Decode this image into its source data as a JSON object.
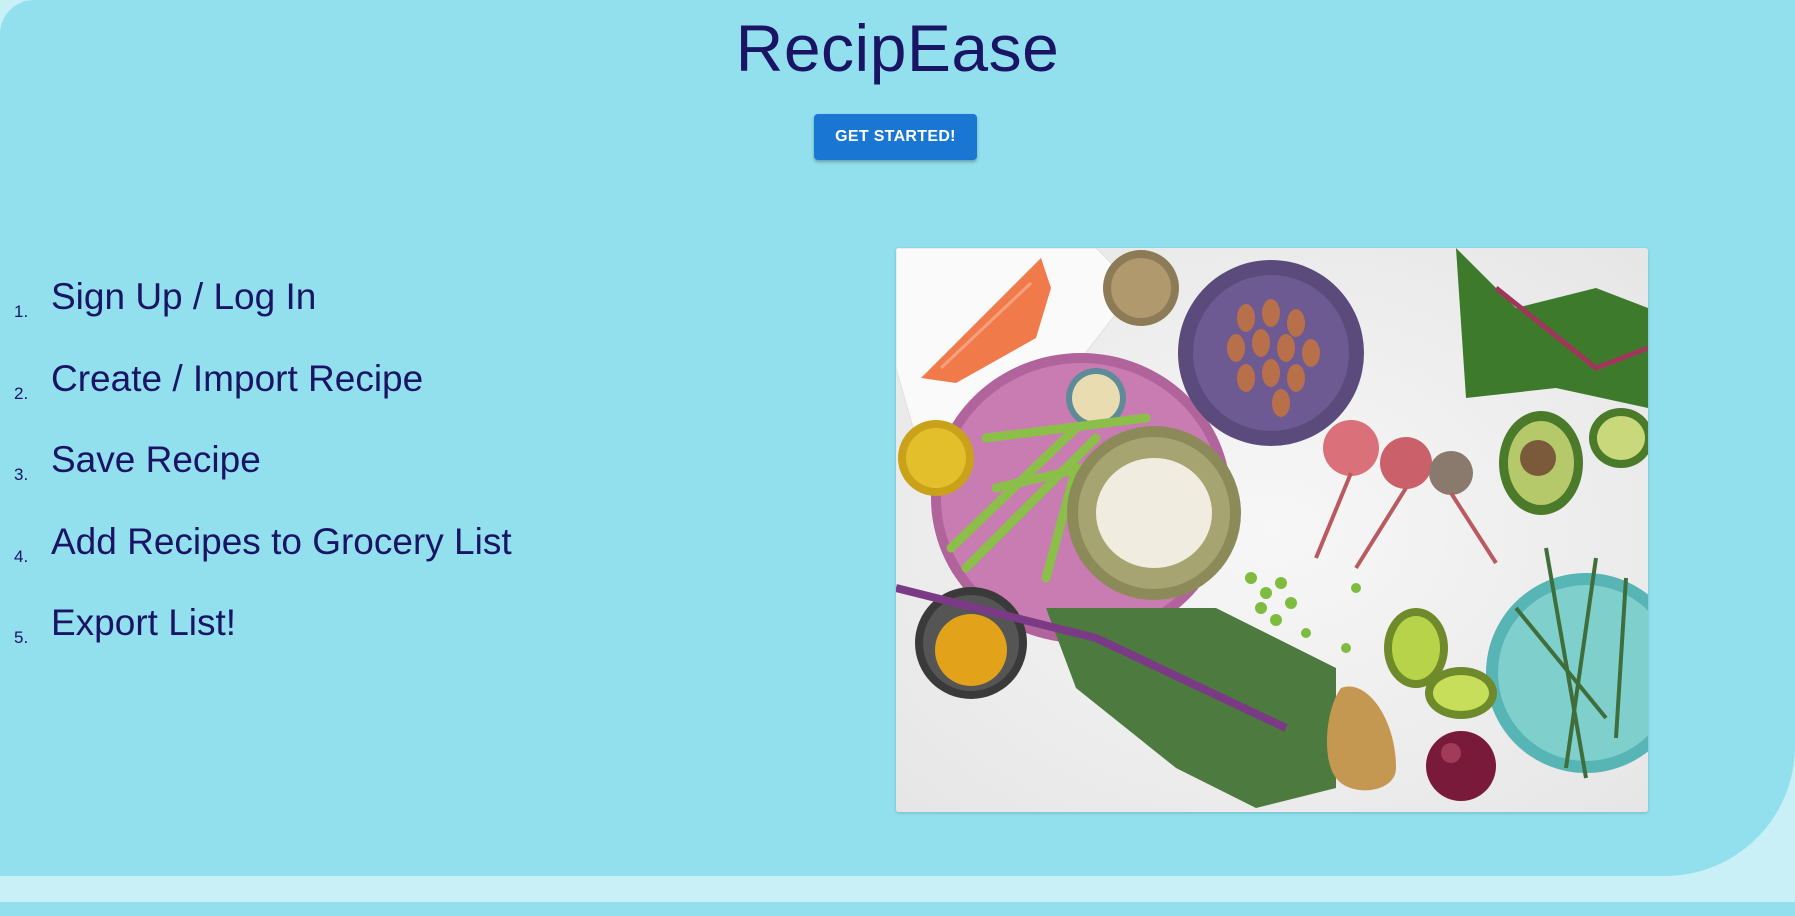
{
  "app": {
    "title": "RecipEase"
  },
  "hero": {
    "cta_label": "GET STARTED!"
  },
  "steps": [
    {
      "number": "1.",
      "label": "Sign Up / Log In"
    },
    {
      "number": "2.",
      "label": "Create / Import Recipe"
    },
    {
      "number": "3.",
      "label": "Save Recipe"
    },
    {
      "number": "4.",
      "label": "Add Recipes to Grocery List"
    },
    {
      "number": "5.",
      "label": "Export List!"
    }
  ],
  "colors": {
    "page_background": "#c9f0f7",
    "hero_background": "#92dfee",
    "text_primary": "#1a1464",
    "button_background": "#1976d2",
    "button_text": "#ffffff"
  },
  "image": {
    "icon": "food-ingredients-photo"
  }
}
